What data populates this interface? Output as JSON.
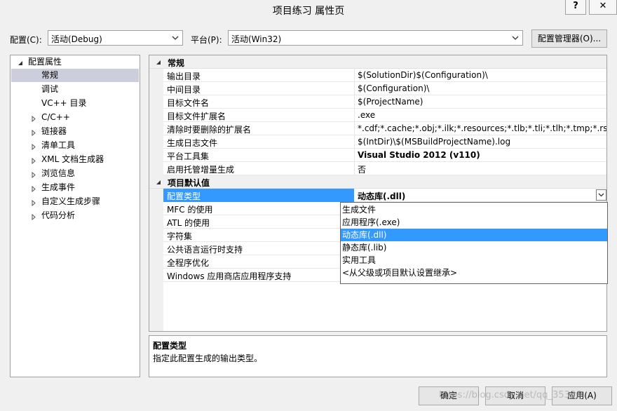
{
  "window": {
    "title": "项目练习 属性页",
    "help_btn": "?",
    "close_btn": "✕"
  },
  "toolbar": {
    "config_label": "配置(C):",
    "config_value": "活动(Debug)",
    "platform_label": "平台(P):",
    "platform_value": "活动(Win32)",
    "config_manager": "配置管理器(O)..."
  },
  "tree": {
    "root": "配置属性",
    "items": [
      "常规",
      "调试",
      "VC++ 目录",
      "C/C++",
      "链接器",
      "清单工具",
      "XML 文档生成器",
      "浏览信息",
      "生成事件",
      "自定义生成步骤",
      "代码分析"
    ]
  },
  "grid": {
    "cat1": "常规",
    "general": [
      {
        "name": "输出目录",
        "value": "$(SolutionDir)$(Configuration)\\"
      },
      {
        "name": "中间目录",
        "value": "$(Configuration)\\"
      },
      {
        "name": "目标文件名",
        "value": "$(ProjectName)"
      },
      {
        "name": "目标文件扩展名",
        "value": ".exe"
      },
      {
        "name": "清除时要删除的扩展名",
        "value": "*.cdf;*.cache;*.obj;*.ilk;*.resources;*.tlb;*.tli;*.tlh;*.tmp;*.rsp;*.pgc;*.p"
      },
      {
        "name": "生成日志文件",
        "value": "$(IntDir)\\$(MSBuildProjectName).log"
      },
      {
        "name": "平台工具集",
        "value": "Visual Studio 2012 (v110)"
      },
      {
        "name": "启用托管增量生成",
        "value": "否"
      }
    ],
    "cat2": "项目默认值",
    "defaults": [
      {
        "name": "配置类型",
        "value": "动态库(.dll)"
      },
      {
        "name": "MFC 的使用",
        "value": ""
      },
      {
        "name": "ATL 的使用",
        "value": ""
      },
      {
        "name": "字符集",
        "value": ""
      },
      {
        "name": "公共语言运行时支持",
        "value": ""
      },
      {
        "name": "全程序优化",
        "value": ""
      },
      {
        "name": "Windows 应用商店应用程序支持",
        "value": ""
      }
    ]
  },
  "dropdown": {
    "options": [
      "生成文件",
      "应用程序(.exe)",
      "动态库(.dll)",
      "静态库(.lib)",
      "实用工具",
      "<从父级或项目默认设置继承>"
    ]
  },
  "description": {
    "title": "配置类型",
    "text": "指定此配置生成的输出类型。"
  },
  "buttons": {
    "ok": "确定",
    "cancel": "取消",
    "apply": "应用(A)"
  },
  "watermark": "https://blog.csdn.net/qq_35386"
}
